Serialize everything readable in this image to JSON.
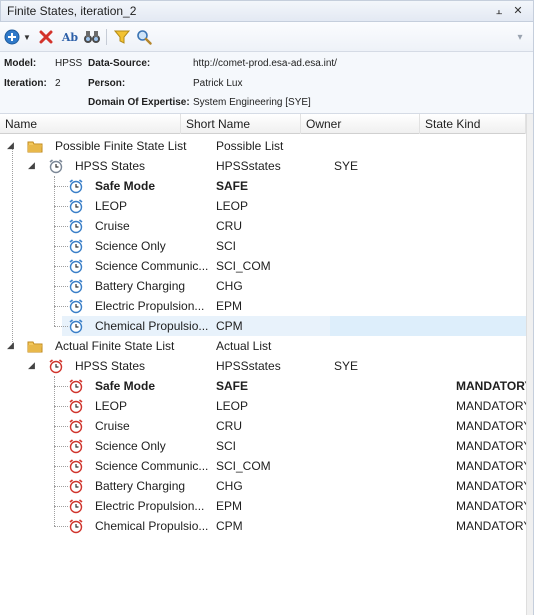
{
  "window": {
    "title": "Finite States, iteration_2",
    "pin_glyph": "⫠",
    "close_glyph": "✕",
    "menu_glyph": "▾"
  },
  "toolbar": {
    "add_icon": "add-icon",
    "delete_icon": "delete-icon",
    "spell_icon": "spellcheck-icon",
    "spell_text": "Ab",
    "find_icon": "binoculars-icon",
    "filter_icon": "filter-icon",
    "search_icon": "magnifier-icon"
  },
  "info": {
    "model_label": "Model:",
    "model_value": "HPSS",
    "iteration_label": "Iteration:",
    "iteration_value": "2",
    "datasource_label": "Data-Source:",
    "datasource_value": "http://comet-prod.esa-ad.esa.int/",
    "person_label": "Person:",
    "person_value": "Patrick Lux",
    "domain_label": "Domain Of Expertise:",
    "domain_value": "System Engineering [SYE]"
  },
  "columns": {
    "name": "Name",
    "short_name": "Short Name",
    "owner": "Owner",
    "state_kind": "State Kind"
  },
  "possible": {
    "name": "Possible Finite State List",
    "short": "Possible List",
    "group": {
      "name": "HPSS States",
      "short": "HPSSstates",
      "owner": "SYE"
    },
    "states": [
      {
        "name": "Safe Mode",
        "short": "SAFE"
      },
      {
        "name": "LEOP",
        "short": "LEOP"
      },
      {
        "name": "Cruise",
        "short": "CRU"
      },
      {
        "name": "Science Only",
        "short": "SCI"
      },
      {
        "name": "Science Communic...",
        "short": "SCI_COM"
      },
      {
        "name": "Battery Charging",
        "short": "CHG"
      },
      {
        "name": "Electric Propulsion...",
        "short": "EPM"
      },
      {
        "name": "Chemical Propulsio...",
        "short": "CPM"
      }
    ]
  },
  "actual": {
    "name": "Actual Finite State List",
    "short": "Actual List",
    "group": {
      "name": "HPSS States",
      "short": "HPSSstates",
      "owner": "SYE"
    },
    "states": [
      {
        "name": "Safe Mode",
        "short": "SAFE",
        "kind": "MANDATORY"
      },
      {
        "name": "LEOP",
        "short": "LEOP",
        "kind": "MANDATORY"
      },
      {
        "name": "Cruise",
        "short": "CRU",
        "kind": "MANDATORY"
      },
      {
        "name": "Science Only",
        "short": "SCI",
        "kind": "MANDATORY"
      },
      {
        "name": "Science Communic...",
        "short": "SCI_COM",
        "kind": "MANDATORY"
      },
      {
        "name": "Battery Charging",
        "short": "CHG",
        "kind": "MANDATORY"
      },
      {
        "name": "Electric Propulsion...",
        "short": "EPM",
        "kind": "MANDATORY"
      },
      {
        "name": "Chemical Propulsio...",
        "short": "CPM",
        "kind": "MANDATORY"
      }
    ]
  },
  "colors": {
    "selection": "#e8f2fb",
    "folder": "#e8b84a",
    "clock_blue": "#3a7fc8",
    "clock_red": "#d0342c"
  }
}
